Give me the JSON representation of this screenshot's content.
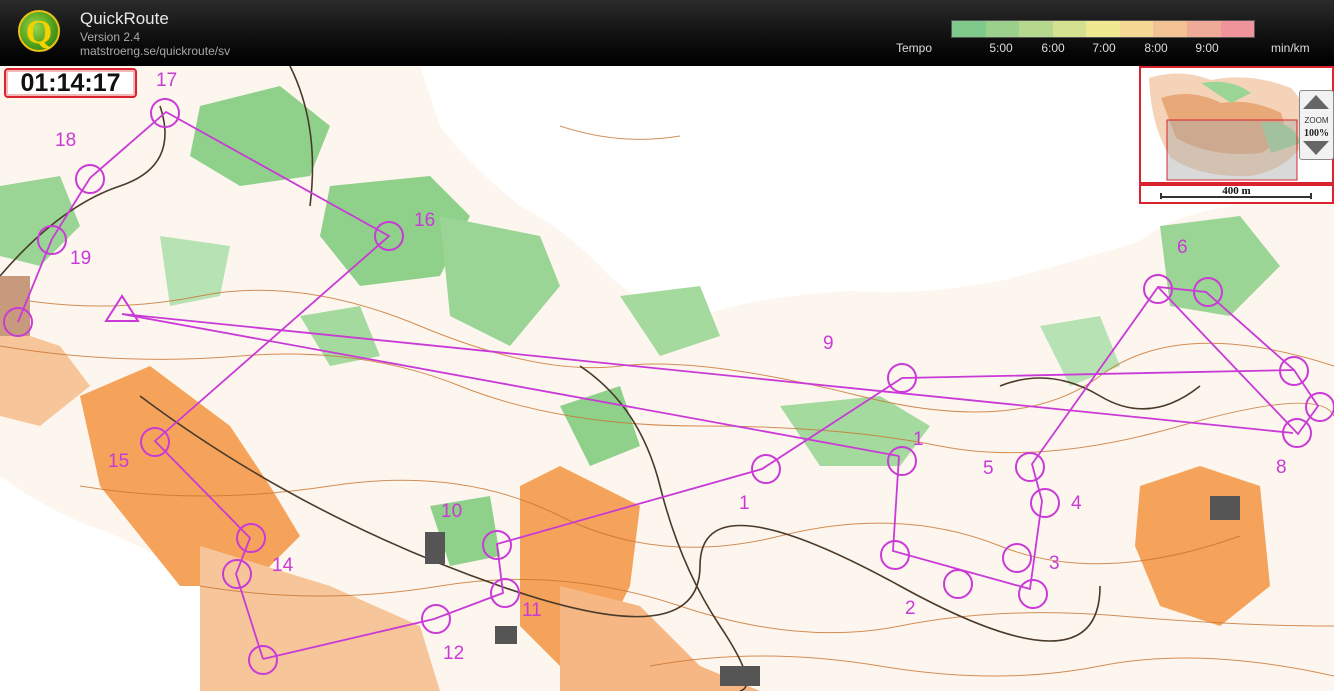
{
  "app": {
    "name": "QuickRoute",
    "version": "Version 2.4",
    "url": "matstroeng.se/quickroute/sv",
    "logo_letter": "Q"
  },
  "tempo": {
    "label": "Tempo",
    "unit": "min/km",
    "ticks": [
      "5:00",
      "6:00",
      "7:00",
      "8:00",
      "9:00"
    ],
    "scale_colors": [
      "#7fc98a",
      "#9ad08c",
      "#b6d88e",
      "#d3e190",
      "#efe991",
      "#f3d994",
      "#f2c295",
      "#f0ab98",
      "#ee949a"
    ]
  },
  "timer": {
    "value": "01:14:17"
  },
  "overview": {
    "zoom_label": "ZOOM",
    "zoom_value": "100%",
    "scale_label": "400 m"
  },
  "map": {
    "course_color": "#c93ad6",
    "controls": [
      {
        "label": "1"
      },
      {
        "label": "1"
      },
      {
        "label": "2"
      },
      {
        "label": "3"
      },
      {
        "label": "4"
      },
      {
        "label": "5"
      },
      {
        "label": "6"
      },
      {
        "label": "8"
      },
      {
        "label": "9"
      },
      {
        "label": "10"
      },
      {
        "label": "11"
      },
      {
        "label": "12"
      },
      {
        "label": "14"
      },
      {
        "label": "15"
      },
      {
        "label": "16"
      },
      {
        "label": "17"
      },
      {
        "label": "18"
      },
      {
        "label": "19"
      }
    ]
  }
}
